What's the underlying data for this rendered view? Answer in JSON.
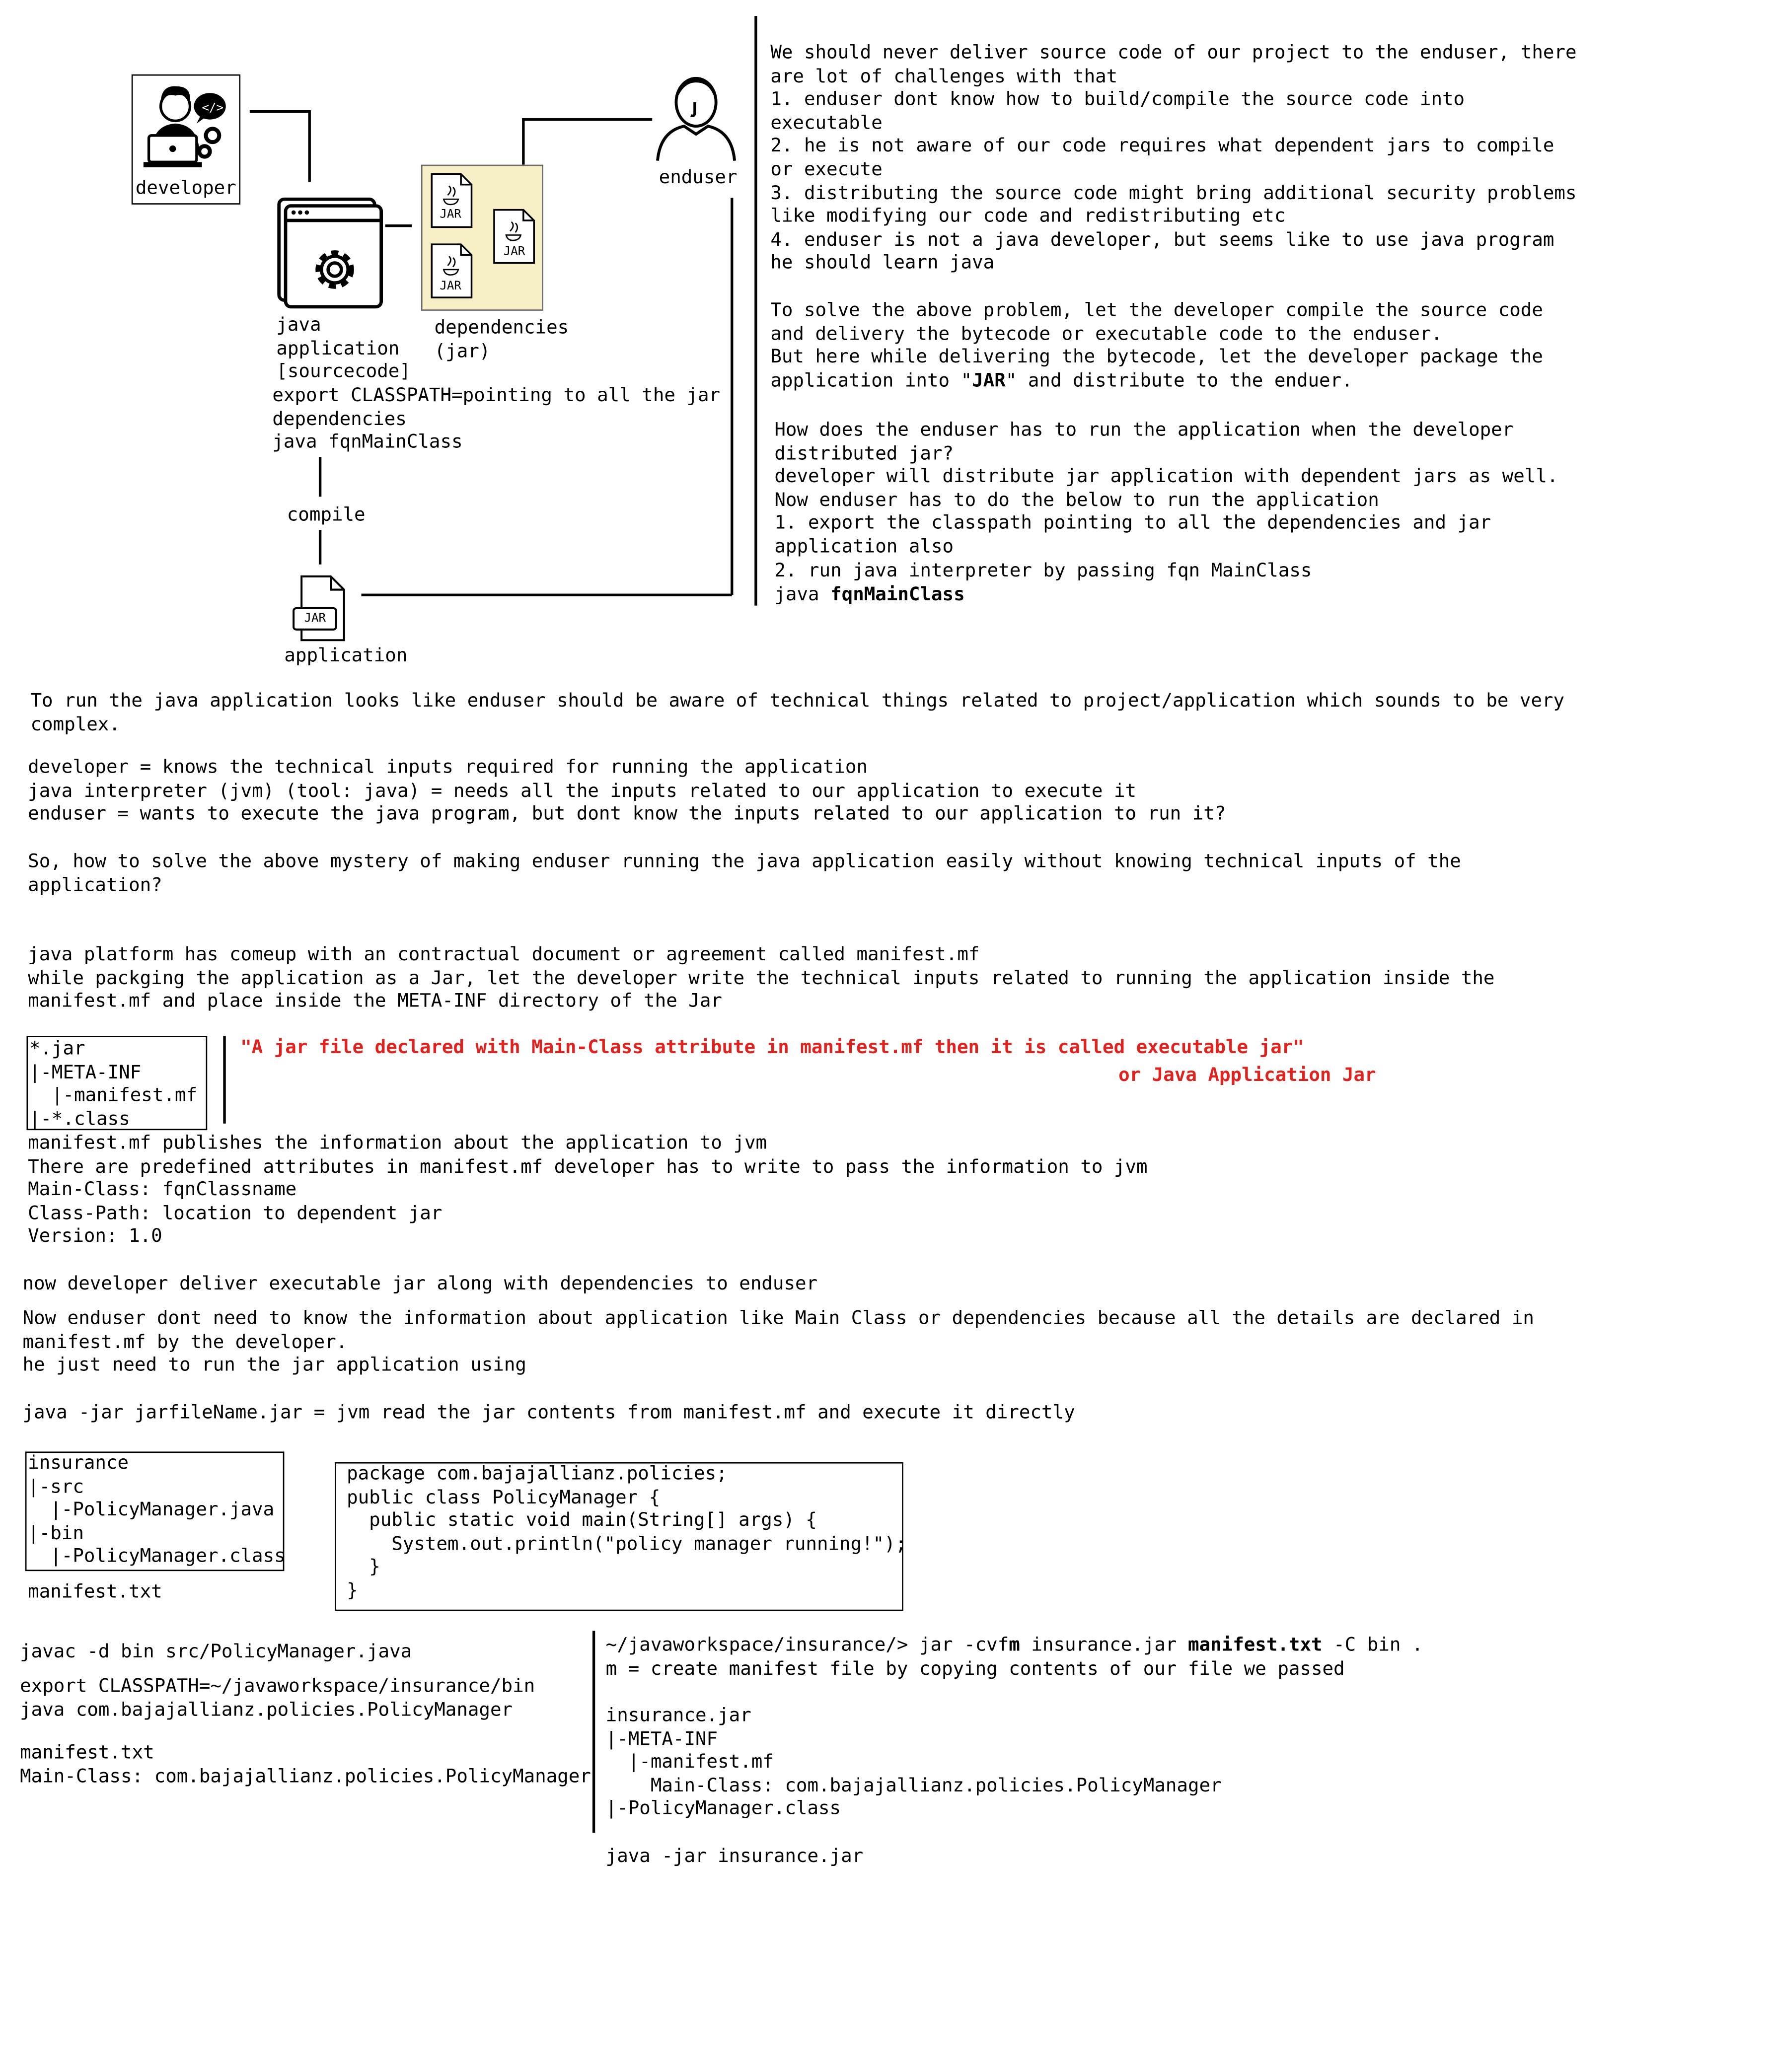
{
  "diagram": {
    "developer_label": "developer",
    "enduser_label": "enduser",
    "java_app_label": "java\napplication\n[sourcecode]",
    "dependencies_label": "dependencies\n(jar)",
    "jar_badge": "JAR",
    "classpath_note": "export CLASSPATH=pointing to all the jar\ndependencies\njava fqnMainClass",
    "compile_label": "compile",
    "application_label": "application"
  },
  "right_notes": {
    "intro": "We should never deliver source code of our project to the enduser, there\nare lot of challenges with that\n1. enduser dont know how to build/compile the source code into\nexecutable\n2. he is not aware of our code requires what dependent jars to compile\nor execute\n3. distributing the source code might bring additional security problems\nlike modifying our code and redistributing etc\n4. enduser is not a java developer, but seems like to use java program\nhe should learn java",
    "solve_pre": "To solve the above problem, let the developer compile the source code\nand delivery the bytecode or executable code to the enduser.\nBut here while delivering the bytecode, let the developer package the\napplication into \"",
    "solve_bold": "JAR",
    "solve_post": "\" and distribute to the enduer.",
    "how_run": "How does the enduser has to run the application when the developer\ndistributed jar?\ndeveloper will distribute jar application with dependent jars as well.\nNow enduser has to do the below to run the application\n1. export the classpath pointing to all the dependencies and jar\napplication also\n2. run java interpreter by passing fqn MainClass",
    "java_cmd": "java ",
    "java_cmd_bold": "fqnMainClass"
  },
  "body": {
    "p1": "To run the java application looks like enduser should be aware of technical things related to project/application which sounds to be very\ncomplex.",
    "p2": "developer = knows the technical inputs required for running the application\njava interpreter (jvm) (tool: java) = needs all the inputs related to our application to execute it\nenduser = wants to execute the java program, but dont know the inputs related to our application to run it?",
    "p3": "So, how to solve the above mystery of making enduser running the java application easily without knowing technical inputs of the\napplication?",
    "p4": "java platform has comeup with an contractual document or agreement called manifest.mf\nwhile packging the application as a Jar, let the developer write the technical inputs related to running the application inside the\nmanifest.mf and place inside the META-INF directory of the Jar",
    "jar_tree": "*.jar\n|-META-INF\n  |-manifest.mf\n|-*.class",
    "quote_line1": "\"A jar file declared with Main-Class attribute in manifest.mf then it is called executable jar\"",
    "quote_line2": "or Java Application Jar",
    "p5": "manifest.mf publishes the information about the application to jvm\nThere are predefined attributes in manifest.mf developer has to write to pass the information to jvm\nMain-Class: fqnClassname\nClass-Path: location to dependent jar\nVersion: 1.0",
    "p6": "now developer deliver executable jar along with dependencies to enduser",
    "p7": "Now enduser dont need to know the information about application like Main Class or dependencies because all the details are declared in\nmanifest.mf by the developer.\nhe just need to run the jar application using",
    "p8": "java -jar jarfileName.jar = jvm read the jar contents from manifest.mf and execute it directly"
  },
  "example": {
    "project_tree": "insurance\n|-src\n  |-PolicyManager.java\n|-bin\n  |-PolicyManager.class",
    "manifest_file": "manifest.txt",
    "code": "package com.bajajallianz.policies;\npublic class PolicyManager {\n  public static void main(String[] args) {\n    System.out.println(\"policy manager running!\");\n  }\n}",
    "compile_cmd": "javac -d bin src/PolicyManager.java",
    "run_cmds": "export CLASSPATH=~/javaworkspace/insurance/bin\njava com.bajajallianz.policies.PolicyManager",
    "manifest_content": "manifest.txt\nMain-Class: com.bajajallianz.policies.PolicyManager",
    "jar_cmd_pre": "~/javaworkspace/insurance/> jar -cvf",
    "jar_cmd_m": "m",
    "jar_cmd_mid": " insurance.jar ",
    "jar_cmd_bold": "manifest.txt",
    "jar_cmd_post": " -C bin .",
    "jar_cmd_note": "m = create manifest file by copying contents of our file we passed",
    "jar_tree": "insurance.jar\n|-META-INF\n  |-manifest.mf\n    Main-Class: com.bajajallianz.policies.PolicyManager\n|-PolicyManager.class",
    "run_jar": "java -jar insurance.jar"
  }
}
